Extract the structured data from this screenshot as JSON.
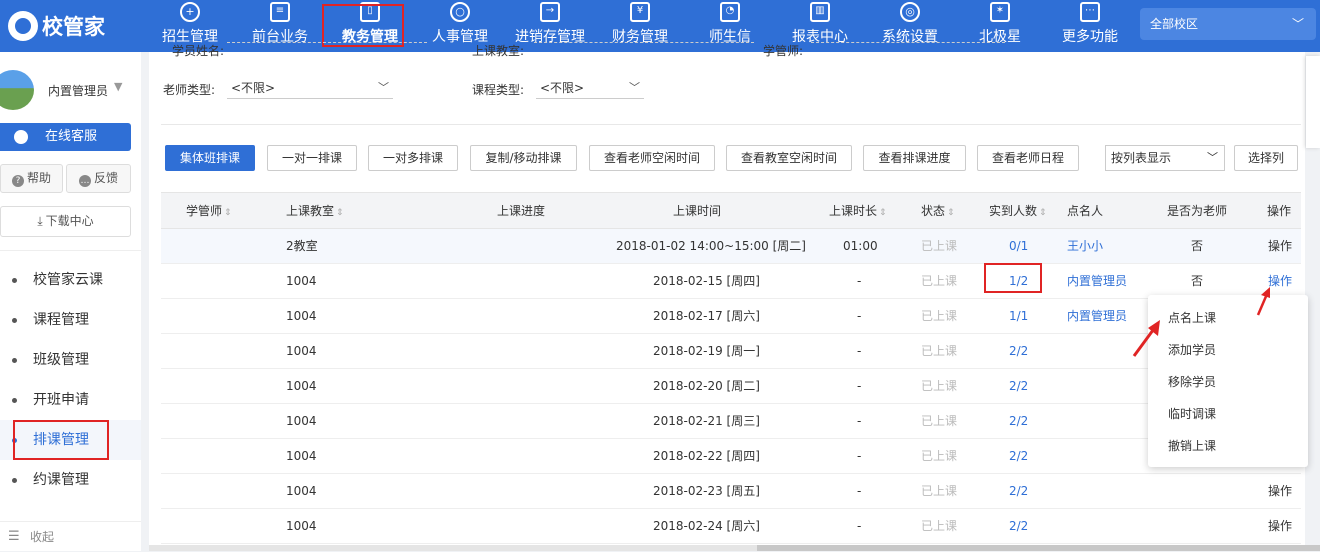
{
  "brand": {
    "logo_text": "校管家"
  },
  "nav": {
    "items": [
      {
        "label": "招生管理",
        "icon": "user-plus-icon",
        "glyph": "+"
      },
      {
        "label": "前台业务",
        "icon": "desk-icon",
        "glyph": "≡"
      },
      {
        "label": "教务管理",
        "icon": "book-icon",
        "glyph": "▯"
      },
      {
        "label": "人事管理",
        "icon": "person-icon",
        "glyph": "○"
      },
      {
        "label": "进销存管理",
        "icon": "inventory-icon",
        "glyph": "→"
      },
      {
        "label": "财务管理",
        "icon": "finance-icon",
        "glyph": "¥"
      },
      {
        "label": "师生信",
        "icon": "message-icon",
        "glyph": "◔"
      },
      {
        "label": "报表中心",
        "icon": "report-icon",
        "glyph": "▥"
      },
      {
        "label": "系统设置",
        "icon": "settings-icon",
        "glyph": "◎"
      },
      {
        "label": "北极星",
        "icon": "star-icon",
        "glyph": "✶"
      },
      {
        "label": "更多功能",
        "icon": "more-icon",
        "glyph": "⋯"
      }
    ],
    "active_index": 2,
    "campus_select": "全部校区"
  },
  "sidebar": {
    "user_name": "内置管理员",
    "service_label": "在线客服",
    "help_label": "帮助",
    "feedback_label": "反馈",
    "download_label": "下载中心",
    "menu": [
      "校管家云课",
      "课程管理",
      "班级管理",
      "开班申请",
      "排课管理",
      "约课管理"
    ],
    "active_menu": 4,
    "collapse_label": "收起"
  },
  "filters": {
    "cut_labels": [
      "学员姓名:",
      "上课教室:",
      "学管师:"
    ],
    "teacher_type_label": "老师类型:",
    "teacher_type_value": "<不限>",
    "course_type_label": "课程类型:",
    "course_type_value": "<不限>"
  },
  "toolbar": {
    "buttons": [
      "集体班排课",
      "一对一排课",
      "一对多排课",
      "复制/移动排课",
      "查看老师空闲时间",
      "查看教室空闲时间",
      "查看排课进度",
      "查看老师日程"
    ],
    "view_select": "按列表显示",
    "choose_columns": "选择列"
  },
  "table": {
    "headers": [
      "学管师",
      "上课教室",
      "上课进度",
      "上课时间",
      "上课时长",
      "状态",
      "实到人数",
      "点名人",
      "是否为老师",
      "操作"
    ],
    "rows": [
      {
        "room": "2教室",
        "time": "2018-01-02 14:00~15:00 [周二]",
        "duration": "01:00",
        "status": "已上课",
        "attendance": "0/1",
        "caller": "王小小",
        "is_teacher": "否",
        "action": "操作"
      },
      {
        "room": "1004",
        "time": "2018-02-15 [周四]",
        "duration": "-",
        "status": "已上课",
        "attendance": "1/2",
        "caller": "内置管理员",
        "is_teacher": "否",
        "action": "操作"
      },
      {
        "room": "1004",
        "time": "2018-02-17 [周六]",
        "duration": "-",
        "status": "已上课",
        "attendance": "1/1",
        "caller": "内置管理员",
        "is_teacher": "",
        "action": ""
      },
      {
        "room": "1004",
        "time": "2018-02-19 [周一]",
        "duration": "-",
        "status": "已上课",
        "attendance": "2/2",
        "caller": "",
        "is_teacher": "",
        "action": ""
      },
      {
        "room": "1004",
        "time": "2018-02-20 [周二]",
        "duration": "-",
        "status": "已上课",
        "attendance": "2/2",
        "caller": "",
        "is_teacher": "",
        "action": ""
      },
      {
        "room": "1004",
        "time": "2018-02-21 [周三]",
        "duration": "-",
        "status": "已上课",
        "attendance": "2/2",
        "caller": "",
        "is_teacher": "",
        "action": ""
      },
      {
        "room": "1004",
        "time": "2018-02-22 [周四]",
        "duration": "-",
        "status": "已上课",
        "attendance": "2/2",
        "caller": "",
        "is_teacher": "",
        "action": ""
      },
      {
        "room": "1004",
        "time": "2018-02-23 [周五]",
        "duration": "-",
        "status": "已上课",
        "attendance": "2/2",
        "caller": "",
        "is_teacher": "",
        "action": "操作"
      },
      {
        "room": "1004",
        "time": "2018-02-24 [周六]",
        "duration": "-",
        "status": "已上课",
        "attendance": "2/2",
        "caller": "",
        "is_teacher": "",
        "action": "操作"
      }
    ]
  },
  "action_menu": [
    "点名上课",
    "添加学员",
    "移除学员",
    "临时调课",
    "撤销上课"
  ],
  "colors": {
    "primary": "#2f6fd6",
    "highlight": "#e02424",
    "status_gray": "#bbbbbb"
  }
}
